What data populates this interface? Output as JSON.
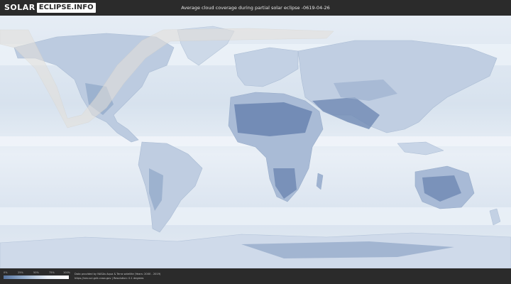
{
  "header": {
    "logo_solar": "SOLAR",
    "logo_eclipse": "ECLIPSE.INFO",
    "title": "Average cloud coverage during partial solar eclipse -0619-04-26"
  },
  "legend": {
    "ticks": [
      "0%",
      "25%",
      "50%",
      "75%",
      "100%"
    ],
    "colors": [
      "#55739e",
      "#9bb3d0",
      "#e8eef6",
      "#ffffff"
    ]
  },
  "credits": {
    "line1": "Data provided by NASAs Aqua & Terra satellite (Years: 2000 - 2019)",
    "line2": "https://neo.sci.gsfc.nasa.gov | Resolution: 0.1 degrees"
  },
  "map": {
    "ocean_color": "#dde6f0",
    "clear_sky_color": "#5e78a6",
    "eclipse_zone_color": "#e4e0da"
  }
}
